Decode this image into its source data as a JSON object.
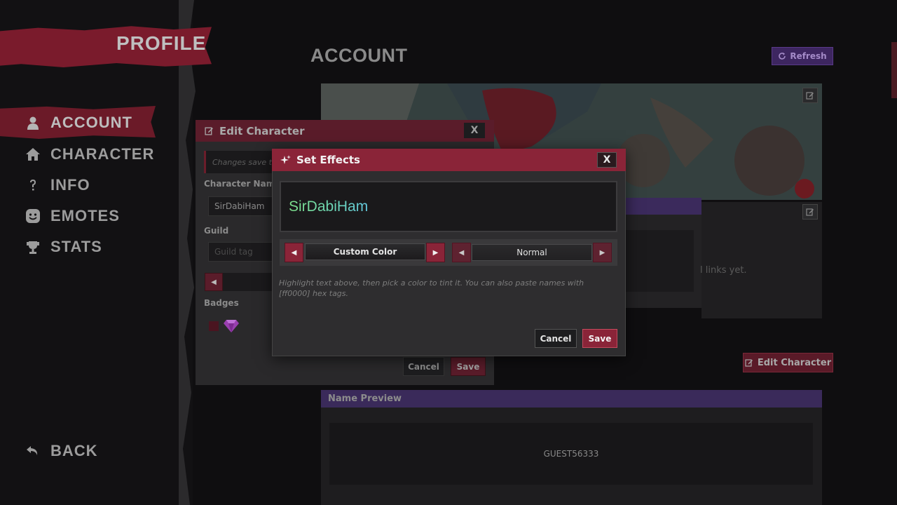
{
  "sidebar": {
    "title": "PROFILE",
    "items": [
      {
        "label": "ACCOUNT",
        "icon": "person-icon"
      },
      {
        "label": "CHARACTER",
        "icon": "home-icon"
      },
      {
        "label": "INFO",
        "icon": "question-icon"
      },
      {
        "label": "EMOTES",
        "icon": "smiley-icon"
      },
      {
        "label": "STATS",
        "icon": "trophy-icon"
      }
    ],
    "back_label": "BACK"
  },
  "main": {
    "title": "ACCOUNT",
    "refresh_label": "Refresh",
    "links_text": "l links yet.",
    "edit_character_label": "Edit Character",
    "name_preview": {
      "header": "Name Preview",
      "value": "GUEST56333"
    }
  },
  "edit_character": {
    "title": "Edit Character",
    "close_label": "X",
    "note": "Changes save to",
    "character_name_label": "Character Name",
    "character_name_value": "SirDabiHam",
    "guild_label": "Guild",
    "guild_placeholder": "Guild tag",
    "badges_label": "Badges",
    "cancel_label": "Cancel",
    "save_label": "Save"
  },
  "set_effects": {
    "title": "Set Effects",
    "close_label": "X",
    "preview_text": "SirDabiHam",
    "color_mode": "Custom Color",
    "style_mode": "Normal",
    "hint": "Highlight text above, then pick a color to tint it. You can also paste names with [ff0000] hex tags.",
    "cancel_label": "Cancel",
    "save_label": "Save"
  },
  "colors": {
    "accent": "#8a2438",
    "purple": "#3d2660",
    "preview_gradient_start": "#7de08a",
    "preview_gradient_end": "#63c8de"
  }
}
